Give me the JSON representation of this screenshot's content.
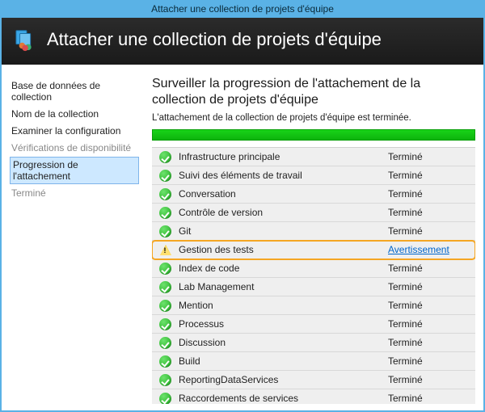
{
  "window": {
    "title": "Attacher une collection de projets d'équipe"
  },
  "header": {
    "title": "Attacher une collection de projets d'équipe"
  },
  "sidebar": {
    "items": [
      {
        "label": "Base de données de collection",
        "state": "normal"
      },
      {
        "label": "Nom de la collection",
        "state": "normal"
      },
      {
        "label": "Examiner la configuration",
        "state": "normal"
      },
      {
        "label": "Vérifications de disponibilité",
        "state": "disabled"
      },
      {
        "label": "Progression de l'attachement",
        "state": "selected"
      },
      {
        "label": "Terminé",
        "state": "disabled"
      }
    ]
  },
  "content": {
    "heading": "Surveiller la progression de l'attachement de la collection de projets d'équipe",
    "subtext": "L'attachement de la collection de projets d'équipe est terminée.",
    "progress_percent": 100
  },
  "statuses": {
    "done": "Terminé",
    "warning": "Avertissement"
  },
  "steps": [
    {
      "label": "Infrastructure principale",
      "status": "done"
    },
    {
      "label": "Suivi des éléments de travail",
      "status": "done"
    },
    {
      "label": "Conversation",
      "status": "done"
    },
    {
      "label": "Contrôle de version",
      "status": "done"
    },
    {
      "label": "Git",
      "status": "done"
    },
    {
      "label": "Gestion des tests",
      "status": "warning",
      "highlighted": true
    },
    {
      "label": "Index de code",
      "status": "done"
    },
    {
      "label": "Lab Management",
      "status": "done"
    },
    {
      "label": "Mention",
      "status": "done"
    },
    {
      "label": "Processus",
      "status": "done"
    },
    {
      "label": "Discussion",
      "status": "done"
    },
    {
      "label": "Build",
      "status": "done"
    },
    {
      "label": "ReportingDataServices",
      "status": "done"
    },
    {
      "label": "Raccordements de services",
      "status": "done"
    }
  ]
}
